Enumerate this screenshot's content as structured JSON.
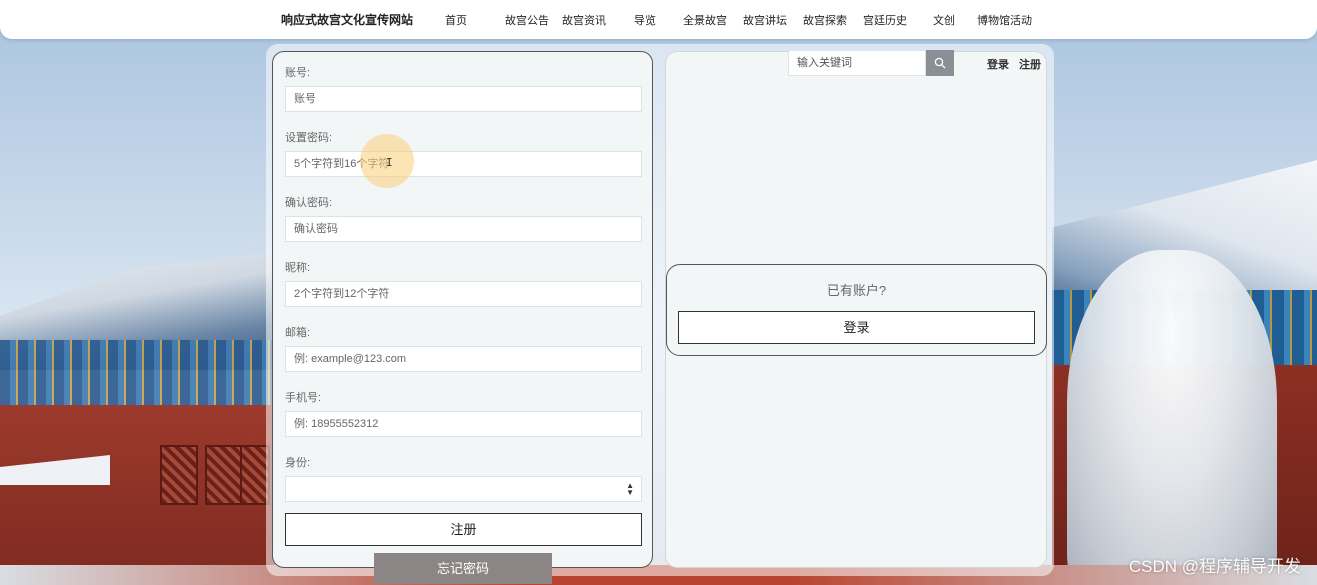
{
  "nav": {
    "site_title": "响应式故宫文化宣传网站",
    "items": [
      "首页",
      "故宫公告",
      "故宫资讯",
      "导览",
      "全景故宫",
      "故宫讲坛",
      "故宫探索",
      "宫廷历史",
      "文创",
      "博物馆活动"
    ]
  },
  "register_form": {
    "account": {
      "label": "账号:",
      "placeholder": "账号"
    },
    "password": {
      "label": "设置密码:",
      "placeholder": "5个字符到16个字符"
    },
    "confirm_password": {
      "label": "确认密码:",
      "placeholder": "确认密码"
    },
    "nickname": {
      "label": "昵称:",
      "placeholder": "2个字符到12个字符"
    },
    "email": {
      "label": "邮箱:",
      "placeholder": "例: example@123.com"
    },
    "phone": {
      "label": "手机号:",
      "placeholder": "例: 18955552312"
    },
    "identity": {
      "label": "身份:",
      "value": ""
    },
    "register_button": "注册",
    "forgot_button": "忘记密码"
  },
  "search": {
    "placeholder": "输入关键词",
    "icon": "search-icon"
  },
  "top_links": {
    "login": "登录",
    "register": "注册"
  },
  "login_card": {
    "question": "已有账户?",
    "login_button": "登录"
  },
  "watermark": "CSDN @程序辅导开发",
  "colors": {
    "forgot_button_bg": "#8c8585",
    "search_button_bg": "#8a8f95",
    "panel_bg": "#f3f6f7"
  }
}
